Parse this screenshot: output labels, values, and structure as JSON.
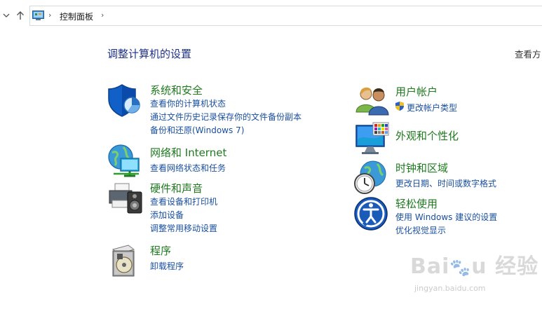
{
  "address_bar": {
    "back_icon": "chevron-down-icon",
    "up_icon": "arrow-up-icon",
    "breadcrumb": [
      "控制面板"
    ]
  },
  "main": {
    "title": "调整计算机的设置",
    "view_by_label": "查看方"
  },
  "categories_left": [
    {
      "icon": "shield-icon",
      "title": "系统和安全",
      "links": [
        "查看你的计算机状态",
        "通过文件历史记录保存你的文件备份副本",
        "备份和还原(Windows 7)"
      ]
    },
    {
      "icon": "network-globe-icon",
      "title": "网络和 Internet",
      "links": [
        "查看网络状态和任务"
      ]
    },
    {
      "icon": "printer-icon",
      "title": "硬件和声音",
      "links": [
        "查看设备和打印机",
        "添加设备",
        "调整常用移动设置"
      ]
    },
    {
      "icon": "programs-icon",
      "title": "程序",
      "links": [
        "卸载程序"
      ]
    }
  ],
  "categories_right": [
    {
      "icon": "users-icon",
      "title": "用户帐户",
      "links": [
        "更改帐户类型"
      ]
    },
    {
      "icon": "monitor-palette-icon",
      "title": "外观和个性化",
      "links": []
    },
    {
      "icon": "clock-globe-icon",
      "title": "时钟和区域",
      "links": [
        "更改日期、时间或数字格式"
      ]
    },
    {
      "icon": "ease-of-access-icon",
      "title": "轻松使用",
      "links": [
        "使用 Windows 建议的设置",
        "优化视觉显示"
      ]
    }
  ],
  "watermark": {
    "logo": "Baidu 经验",
    "url": "jingyan.baidu.com"
  },
  "colors": {
    "title_blue": "#1e3287",
    "category_green": "#1e7a1e",
    "link_blue": "#1a4fa0"
  }
}
